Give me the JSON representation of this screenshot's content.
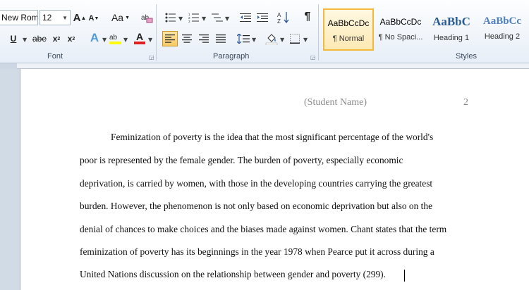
{
  "ribbon": {
    "font": {
      "font_name": "New Rom",
      "font_size": "12",
      "group_label": "Font",
      "grow_font_label": "A",
      "shrink_font_label": "A",
      "change_case_label": "Aa",
      "underline_label": "U",
      "strikethrough_label": "abe",
      "subscript_label": "x",
      "superscript_label": "x",
      "text_effects_label": "A",
      "font_color_label": "A",
      "text_effects_color": "#4f9bd9",
      "highlight_color": "#ffff00",
      "font_color": "#e02020"
    },
    "paragraph": {
      "group_label": "Paragraph",
      "pilcrow_label": "¶"
    },
    "styles": {
      "group_label": "Styles",
      "items": [
        {
          "sample": "AaBbCcDc",
          "name": "¶ Normal",
          "active": true
        },
        {
          "sample": "AaBbCcDc",
          "name": "¶ No Spaci..."
        },
        {
          "sample": "AaBbC",
          "name": "Heading 1"
        },
        {
          "sample": "AaBbCc",
          "name": "Heading 2"
        }
      ]
    }
  },
  "document": {
    "header_name": "(Student Name)",
    "page_number": "2",
    "lines": [
      "Feminization of poverty is the idea that the most significant percentage of the world's",
      "poor is represented by the female gender. The burden of poverty, especially  economic",
      "deprivation, is carried by women, with those in the developing countries carrying the greatest",
      "burden. However, the phenomenon is not only based on economic deprivation but also on the",
      "denial of chances  to make choices and the biases made against women. Chant states that the term",
      "feminization of poverty has its beginnings in the year 1978 when Pearce put it across during a",
      "United Nations  discussion  on the relationship between gender and poverty (299)."
    ]
  }
}
